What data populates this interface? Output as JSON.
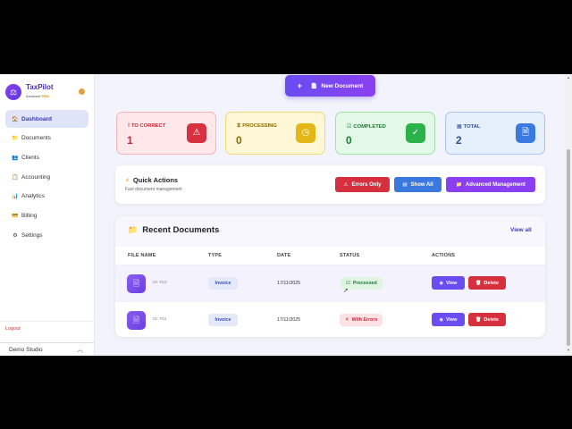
{
  "app": {
    "name": "TaxPilot",
    "subtitle": "Assistant",
    "badge": "PRO"
  },
  "sidebar": {
    "items": [
      {
        "label": "Dashboard",
        "icon": "🏠",
        "active": true
      },
      {
        "label": "Documents",
        "icon": "📁",
        "active": false
      },
      {
        "label": "Clients",
        "icon": "👥",
        "active": false
      },
      {
        "label": "Accounting",
        "icon": "📋",
        "active": false
      },
      {
        "label": "Analytics",
        "icon": "📊",
        "active": false
      },
      {
        "label": "Billing",
        "icon": "💳",
        "active": false
      },
      {
        "label": "Settings",
        "icon": "⚙",
        "active": false
      }
    ],
    "logout": "Logout",
    "workspace": "Demo Studio"
  },
  "header": {
    "new_document": "New Document"
  },
  "stats": {
    "to_correct": {
      "label": "TO CORRECT",
      "value": "1"
    },
    "processing": {
      "label": "PROCESSING",
      "value": "0"
    },
    "completed": {
      "label": "COMPLETED",
      "value": "0"
    },
    "total": {
      "label": "TOTAL",
      "value": "2"
    }
  },
  "quick_actions": {
    "title": "Quick Actions",
    "subtitle": "Fast document management",
    "errors_only": "Errors Only",
    "show_all": "Show All",
    "advanced": "Advanced Management"
  },
  "recent": {
    "title": "Recent Documents",
    "view_all": "View all",
    "columns": [
      "FILE NAME",
      "TYPE",
      "DATE",
      "STATUS",
      "ACTIONS"
    ],
    "rows": [
      {
        "id": "ID: #13",
        "type": "Invoice",
        "date": "17/11/2025",
        "status": "Processed",
        "view": "View",
        "delete": "Delete"
      },
      {
        "id": "ID: #12",
        "type": "Invoice",
        "date": "17/11/2025",
        "status": "With Errors",
        "view": "View",
        "delete": "Delete"
      }
    ]
  },
  "colors": {
    "accent": "#6a4df0",
    "danger": "#d62f3e",
    "info": "#3a78e0",
    "success": "#2cb24a",
    "warning": "#e4b716"
  }
}
